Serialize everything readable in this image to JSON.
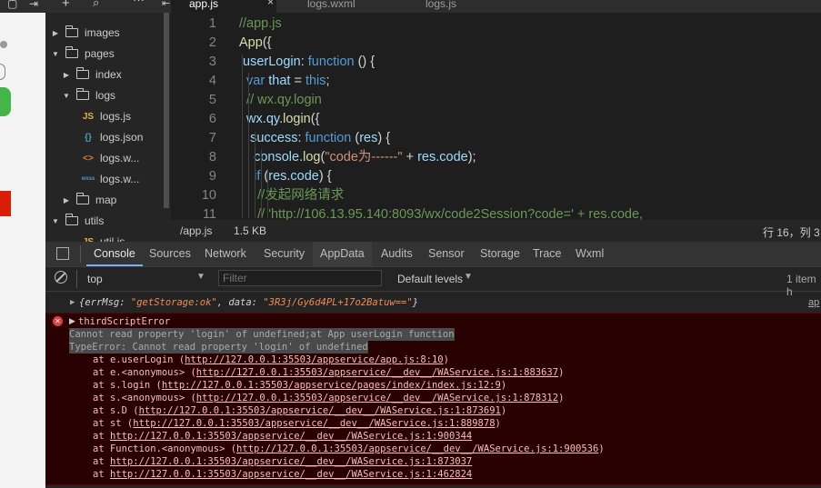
{
  "colors": {
    "editor_bg": "#1e1e1e",
    "error_bg": "#290000",
    "error_text": "#f9bdbd",
    "accent": "#7cacf8"
  },
  "tabs": [
    "app.js",
    "logs.wxml",
    "logs.js"
  ],
  "tree": [
    {
      "label": "images",
      "type": "folder",
      "open": false
    },
    {
      "label": "pages",
      "type": "folder",
      "open": true
    },
    {
      "label": "index",
      "type": "folder",
      "open": false
    },
    {
      "label": "logs",
      "type": "folder",
      "open": true
    },
    {
      "label": "logs.js",
      "type": "js",
      "icon": "JS"
    },
    {
      "label": "logs.json",
      "type": "json",
      "icon": "{}"
    },
    {
      "label": "logs.w...",
      "type": "wxml",
      "icon": "<>"
    },
    {
      "label": "logs.w...",
      "type": "wxss",
      "icon": "wxss"
    },
    {
      "label": "map",
      "type": "folder",
      "open": false
    },
    {
      "label": "utils",
      "type": "folder",
      "open": true
    },
    {
      "label": "util.js",
      "type": "js",
      "icon": "JS"
    }
  ],
  "code": {
    "line_numbers": [
      "1",
      "2",
      "3",
      "4",
      "5",
      "6",
      "7",
      "8",
      "9",
      "10",
      "11"
    ],
    "lines": [
      [
        {
          "t": "//app.js",
          "c": "com"
        }
      ],
      [
        {
          "t": "App",
          "c": "fn"
        },
        {
          "t": "({",
          "c": "pun"
        }
      ],
      [
        {
          "t": " userLogin",
          "c": "id"
        },
        {
          "t": ": ",
          "c": "pun"
        },
        {
          "t": "function",
          "c": "kw"
        },
        {
          "t": " () {",
          "c": "pun"
        }
      ],
      [
        {
          "t": "  var",
          "c": "kw"
        },
        {
          "t": " that",
          "c": "id"
        },
        {
          "t": " = ",
          "c": "pun"
        },
        {
          "t": "this",
          "c": "kw"
        },
        {
          "t": ";",
          "c": "pun"
        }
      ],
      [
        {
          "t": "  // wx.qy.login",
          "c": "com"
        }
      ],
      [
        {
          "t": "  wx",
          "c": "id"
        },
        {
          "t": ".",
          "c": "pun"
        },
        {
          "t": "qy",
          "c": "id"
        },
        {
          "t": ".",
          "c": "pun"
        },
        {
          "t": "login",
          "c": "fn"
        },
        {
          "t": "({",
          "c": "pun"
        }
      ],
      [
        {
          "t": "   success",
          "c": "id"
        },
        {
          "t": ": ",
          "c": "pun"
        },
        {
          "t": "function",
          "c": "kw"
        },
        {
          "t": " (",
          "c": "pun"
        },
        {
          "t": "res",
          "c": "id"
        },
        {
          "t": ") {",
          "c": "pun"
        }
      ],
      [
        {
          "t": "    console",
          "c": "id"
        },
        {
          "t": ".",
          "c": "pun"
        },
        {
          "t": "log",
          "c": "fn"
        },
        {
          "t": "(",
          "c": "pun"
        },
        {
          "t": "\"code为------\"",
          "c": "str"
        },
        {
          "t": " + ",
          "c": "pun"
        },
        {
          "t": "res",
          "c": "id"
        },
        {
          "t": ".",
          "c": "pun"
        },
        {
          "t": "code",
          "c": "id"
        },
        {
          "t": ");",
          "c": "pun"
        }
      ],
      [
        {
          "t": "    if",
          "c": "kw"
        },
        {
          "t": " (",
          "c": "pun"
        },
        {
          "t": "res",
          "c": "id"
        },
        {
          "t": ".",
          "c": "pun"
        },
        {
          "t": "code",
          "c": "id"
        },
        {
          "t": ") {",
          "c": "pun"
        }
      ],
      [
        {
          "t": "     //发起网络请求",
          "c": "com"
        }
      ],
      [
        {
          "t": "     // 'http://106.13.95.140:8093/wx/code2Session?code=' + res.code,",
          "c": "com"
        }
      ]
    ]
  },
  "status": {
    "file": "/app.js",
    "size": "1.5 KB",
    "position": "行 16，列 3"
  },
  "devtools": {
    "tabs": [
      "Console",
      "Sources",
      "Network",
      "Security",
      "AppData",
      "Audits",
      "Sensor",
      "Storage",
      "Trace",
      "Wxml"
    ],
    "context": "top",
    "filter_placeholder": "Filter",
    "levels": "Default levels",
    "count": "1 item h",
    "log_prefix": "{errMsg: ",
    "log_key_val": "\"getStorage:ok\"",
    "log_mid": ", data: ",
    "log_data_val": "\"3R3j/Gy6d4PL+17o2Batuw==\"",
    "log_suffix": "}",
    "log_source": "ap",
    "error_title": "thirdScriptError",
    "error_msg1": "Cannot read property 'login' of undefined;at App userLogin function",
    "error_msg2": "TypeError: Cannot read property 'login' of undefined",
    "stack": [
      {
        "pre": "at e.userLogin (",
        "url": "http://127.0.0.1:35503/appservice/app.js:8:10",
        "post": ")"
      },
      {
        "pre": "at e.<anonymous> (",
        "url": "http://127.0.0.1:35503/appservice/__dev__/WAService.js:1:883637",
        "post": ")"
      },
      {
        "pre": "at s.login (",
        "url": "http://127.0.0.1:35503/appservice/pages/index/index.js:12:9",
        "post": ")"
      },
      {
        "pre": "at s.<anonymous> (",
        "url": "http://127.0.0.1:35503/appservice/__dev__/WAService.js:1:878312",
        "post": ")"
      },
      {
        "pre": "at s.D (",
        "url": "http://127.0.0.1:35503/appservice/__dev__/WAService.js:1:873691",
        "post": ")"
      },
      {
        "pre": "at st (",
        "url": "http://127.0.0.1:35503/appservice/__dev__/WAService.js:1:889878",
        "post": ")"
      },
      {
        "pre": "at ",
        "url": "http://127.0.0.1:35503/appservice/__dev__/WAService.js:1:900344",
        "post": ""
      },
      {
        "pre": "at Function.<anonymous> (",
        "url": "http://127.0.0.1:35503/appservice/__dev__/WAService.js:1:900536",
        "post": ")"
      },
      {
        "pre": "at ",
        "url": "http://127.0.0.1:35503/appservice/__dev__/WAService.js:1:873037",
        "post": ""
      },
      {
        "pre": "at ",
        "url": "http://127.0.0.1:35503/appservice/__dev__/WAService.js:1:462824",
        "post": ""
      }
    ]
  }
}
